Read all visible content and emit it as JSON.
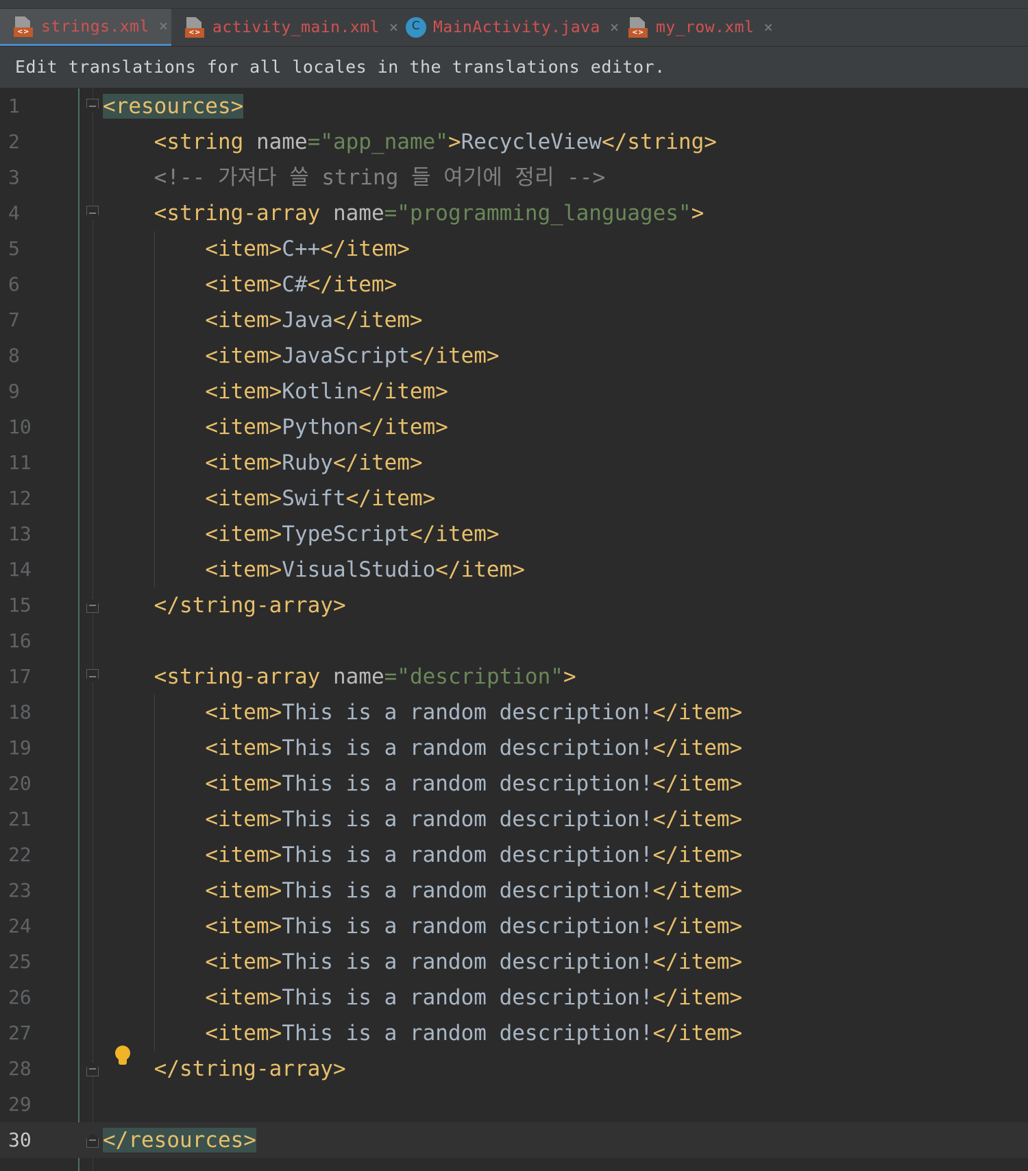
{
  "tabs": [
    {
      "label": "strings.xml",
      "icon": "xml-file-icon",
      "active": true
    },
    {
      "label": "activity_main.xml",
      "icon": "xml-file-icon",
      "active": false
    },
    {
      "label": "MainActivity.java",
      "icon": "java-class-icon",
      "active": false
    },
    {
      "label": "my_row.xml",
      "icon": "xml-file-icon",
      "active": false
    }
  ],
  "tab_close_glyph": "×",
  "xml_badge": "<>",
  "class_badge": "C",
  "notification": "Edit translations for all locales in the translations editor.",
  "line_numbers": [
    "1",
    "2",
    "3",
    "4",
    "5",
    "6",
    "7",
    "8",
    "9",
    "10",
    "11",
    "12",
    "13",
    "14",
    "15",
    "16",
    "17",
    "18",
    "19",
    "20",
    "21",
    "22",
    "23",
    "24",
    "25",
    "26",
    "27",
    "28",
    "29",
    "30"
  ],
  "current_line": 30,
  "code": {
    "resources_open": "<resources>",
    "resources_close": "</resources>",
    "string_open": "<string",
    "name_attr": "name",
    "eq": "=",
    "app_name_value": "\"app_name\"",
    "gt": ">",
    "app_name_text": "RecycleView",
    "string_close": "</string>",
    "comment": "<!-- 가져다 쓸 string 들 여기에 정리 -->",
    "array_open": "<string-array",
    "array_close": "</string-array>",
    "prog_lang_value": "\"programming_languages\"",
    "description_value": "\"description\"",
    "item_open": "<item>",
    "item_close": "</item>",
    "languages": [
      "C++",
      "C#",
      "Java",
      "JavaScript",
      "Kotlin",
      "Python",
      "Ruby",
      "Swift",
      "TypeScript",
      "VisualStudio"
    ],
    "description_text": "This is a random description!"
  },
  "colors": {
    "tag": "#e8bf6a",
    "attribute": "#bababa",
    "value": "#6a8759",
    "comment": "#808080",
    "text": "#a9b7c6",
    "background": "#2b2b2b",
    "tab_text": "#d25252"
  }
}
